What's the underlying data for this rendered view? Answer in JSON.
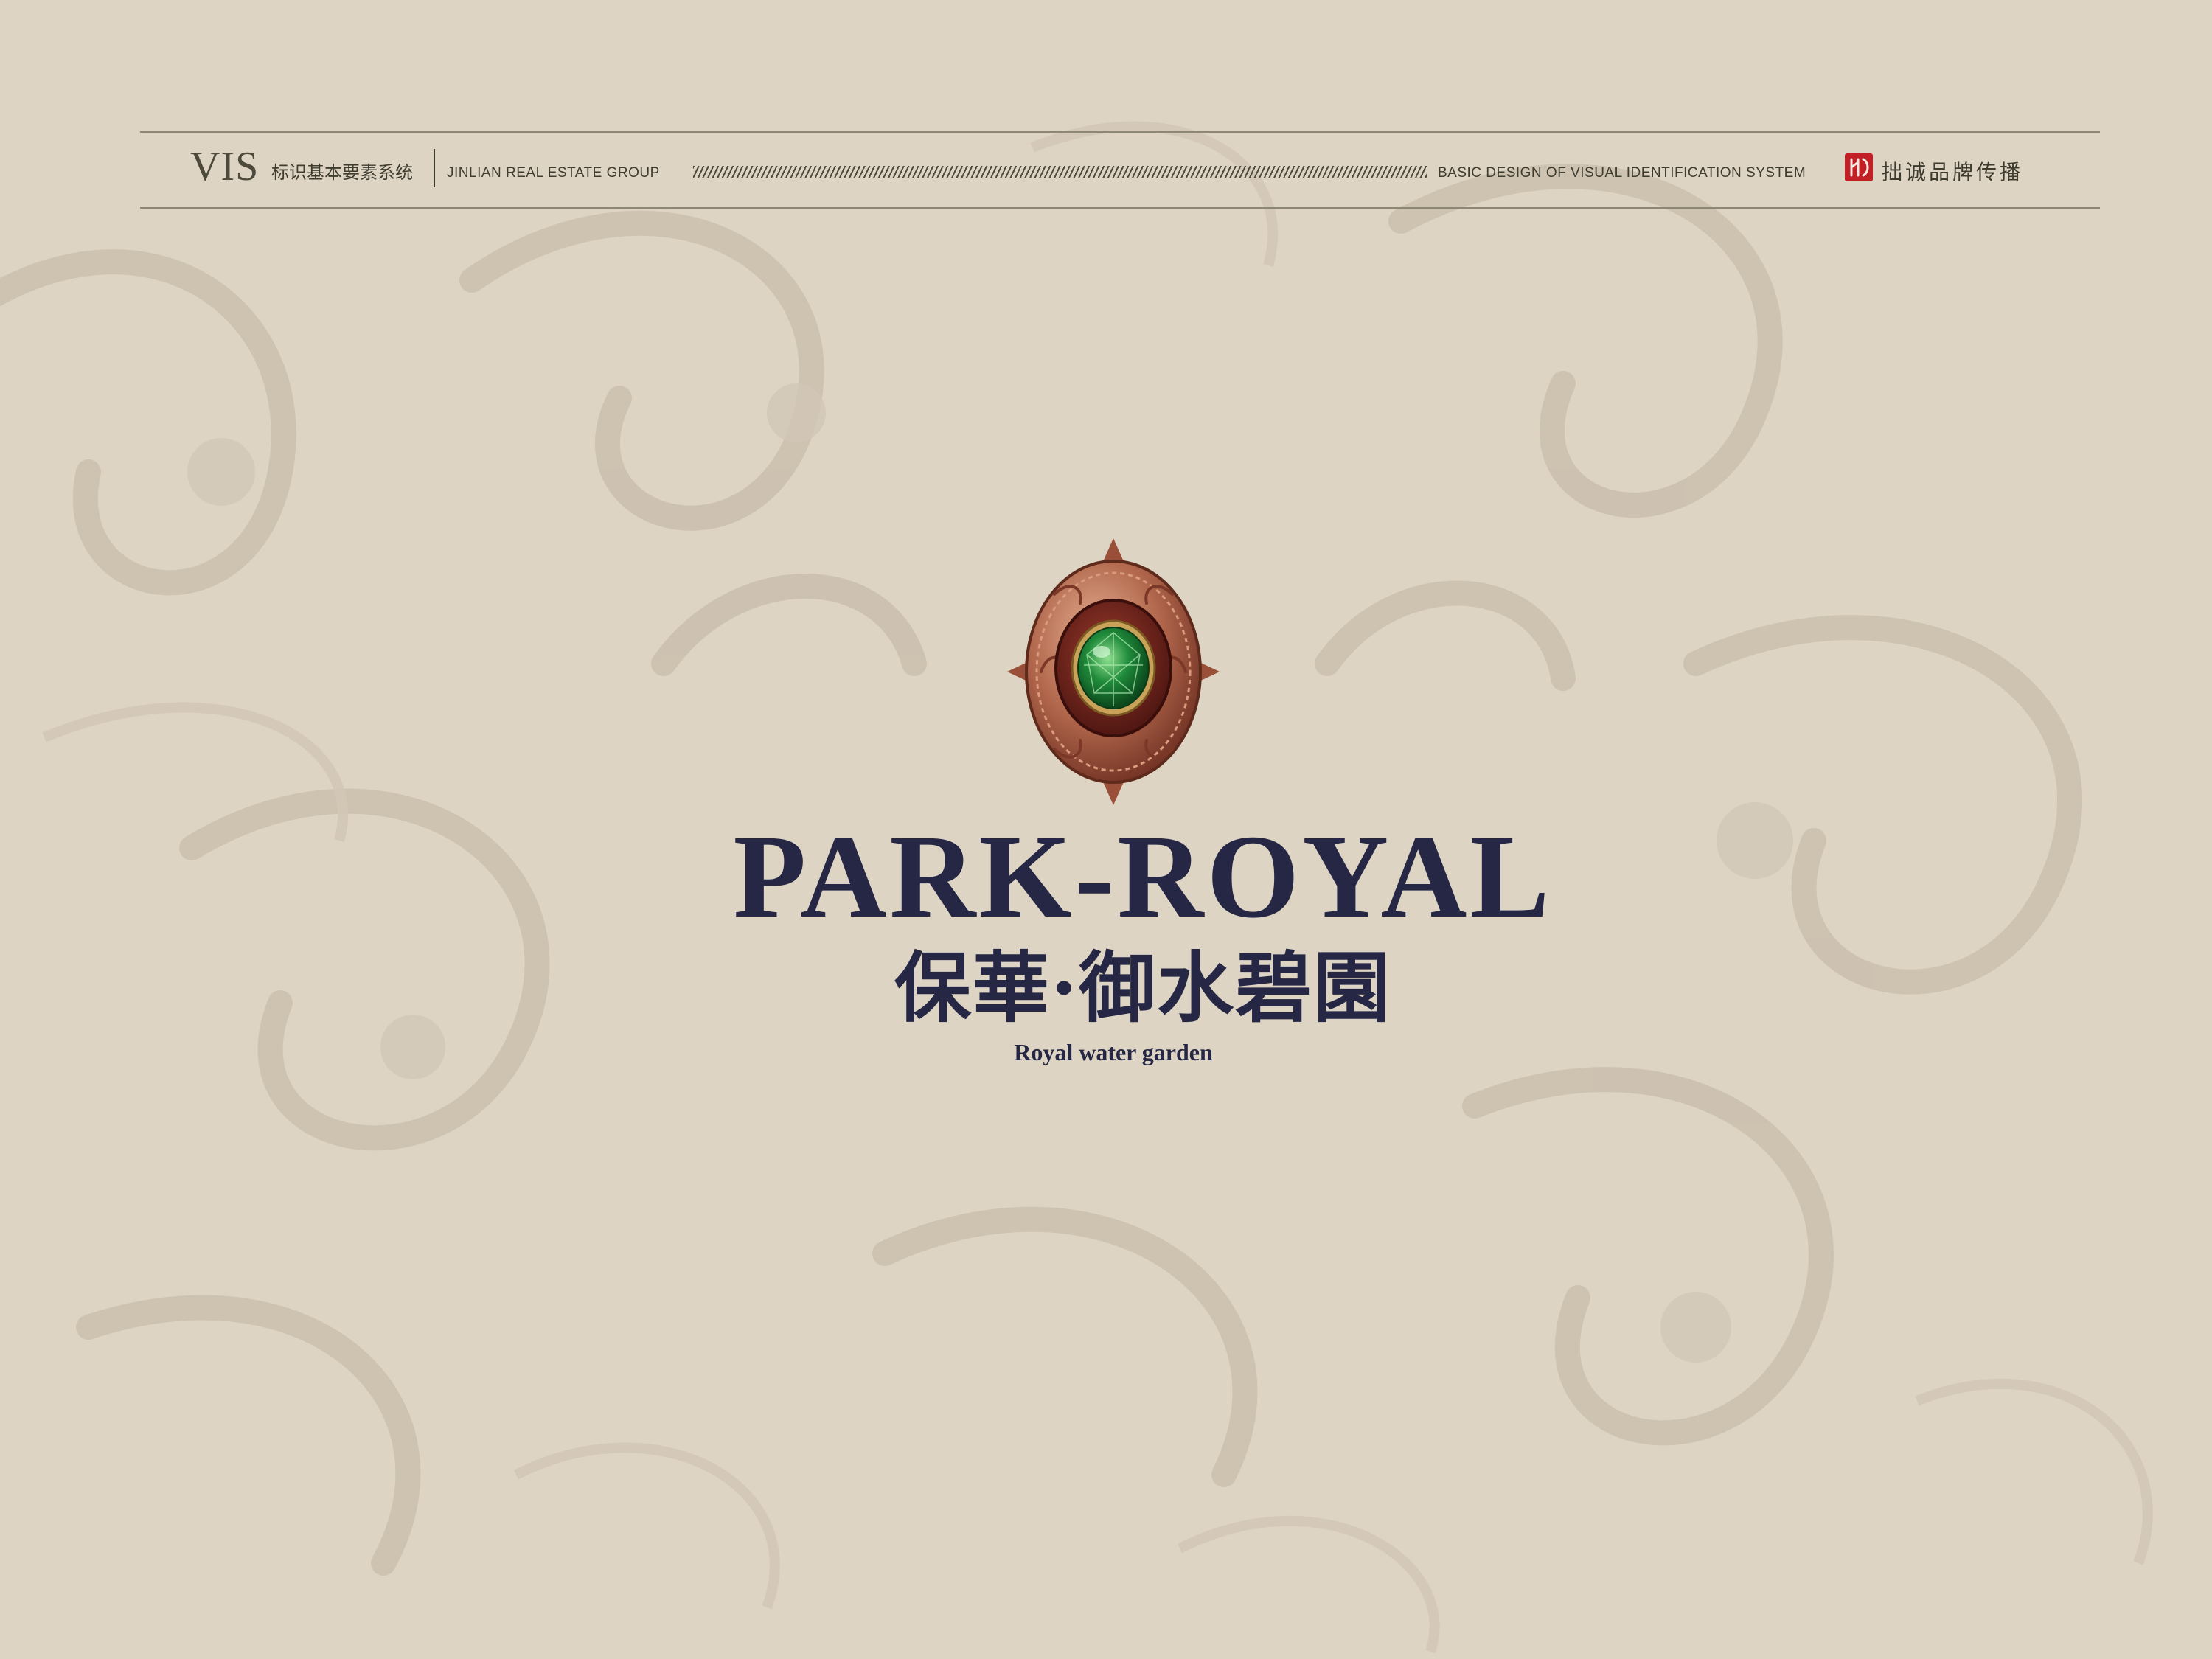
{
  "header": {
    "vis_mark": "VIS",
    "vis_title_cn": "标识基本要素系统",
    "group_name": "JINLIAN REAL ESTATE GROUP",
    "system_name": "BASIC DESIGN OF VISUAL IDENTIFICATION SYSTEM",
    "agency_name": "拙诚品牌传播",
    "agency_logo_icon": "agency-seal-icon"
  },
  "brand": {
    "name_en": "PARK-ROYAL",
    "name_cn": "保華·御水碧園",
    "tagline": "Royal water garden",
    "emblem_icon": "emerald-medallion-icon"
  },
  "colors": {
    "background": "#ddd4c4",
    "pattern": "#cbbfae",
    "navy": "#252744",
    "rule": "#8d8776",
    "seal_red": "#c21f26",
    "copper": "#a0563f",
    "emerald": "#1f8a3a"
  }
}
